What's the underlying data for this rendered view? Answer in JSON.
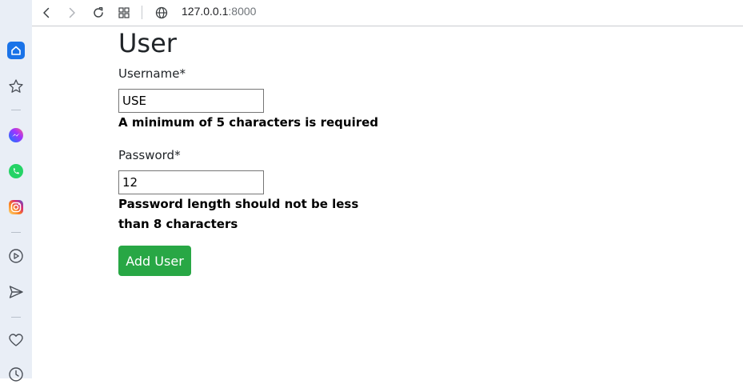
{
  "browser": {
    "url_host": "127.0.0.1",
    "url_port": ":8000"
  },
  "sidebar": {
    "items": [
      {
        "icon": "home-icon"
      },
      {
        "icon": "star-icon"
      },
      {
        "icon": "messenger-icon"
      },
      {
        "icon": "whatsapp-icon"
      },
      {
        "icon": "instagram-icon"
      },
      {
        "icon": "play-icon"
      },
      {
        "icon": "send-icon"
      },
      {
        "icon": "heart-icon"
      },
      {
        "icon": "history-icon"
      }
    ]
  },
  "form": {
    "title": "User",
    "username_label": "Username*",
    "username_value": "USE",
    "username_error": "A minimum of 5 characters is required",
    "password_label": "Password*",
    "password_value": "12",
    "password_error": "Password length should not be less than 8 characters",
    "submit_label": "Add User"
  },
  "colors": {
    "accent_blue": "#1a73e8",
    "submit_green": "#28a745"
  }
}
